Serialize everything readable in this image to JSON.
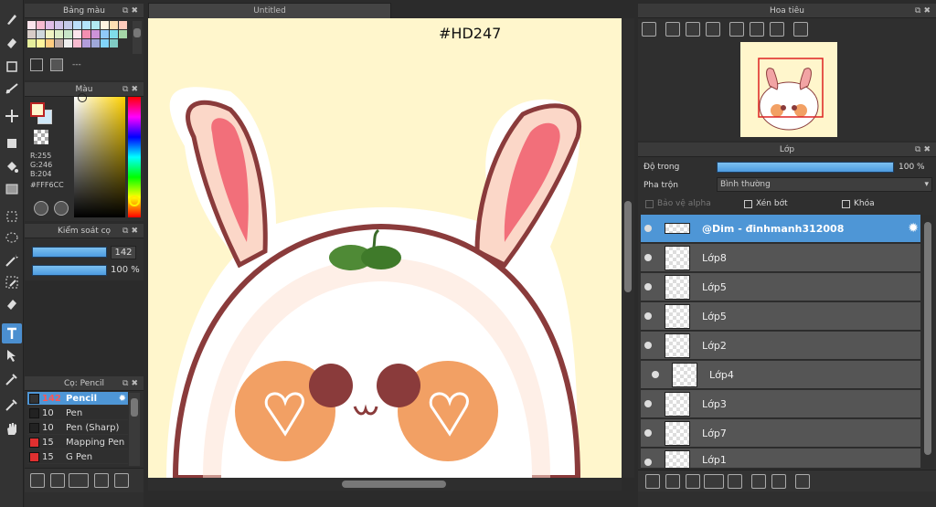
{
  "canvas": {
    "tab_title": "Untitled",
    "watermark": "#HD247",
    "background": "#FFF6CC"
  },
  "palette_panel": {
    "title": "Bảng màu",
    "label": "---",
    "swatches": [
      "#fce4ec",
      "#f8bbd0",
      "#e1bee7",
      "#d1c4e9",
      "#c5cae9",
      "#bbdefb",
      "#b3e5fc",
      "#b2ebf2",
      "#fff3e0",
      "#ffe0b2",
      "#ffccbc",
      "#d7ccc8",
      "#cfd8dc",
      "#f0f4c3",
      "#dcedc8",
      "#c8e6c9",
      "#fce4ec",
      "#f48fb1",
      "#ce93d8",
      "#90caf9",
      "#80deea",
      "#a5d6a7",
      "#e6ee9c",
      "#fff59d",
      "#ffcc80",
      "#bcaaa4",
      "#eeeeee",
      "#f8bbd0",
      "#b39ddb",
      "#9fa8da",
      "#81d4fa",
      "#80cbc4"
    ]
  },
  "color_panel": {
    "title": "Màu",
    "r": "R:255",
    "g": "G:246",
    "b": "B:204",
    "hex": "#FFF6CC",
    "main_color": "#FFF6CC",
    "sub_color": "#7a1a1a"
  },
  "brush_control": {
    "title": "Kiểm soát cọ",
    "size_value": "142",
    "opacity_value": "100 %"
  },
  "brush_panel": {
    "title": "Cọ: Pencil",
    "items": [
      {
        "size": "142",
        "name": "Pencil",
        "color": "#333333"
      },
      {
        "size": "10",
        "name": "Pen",
        "color": "#222222"
      },
      {
        "size": "10",
        "name": "Pen (Sharp)",
        "color": "#222222"
      },
      {
        "size": "15",
        "name": "Mapping Pen",
        "color": "#e03030"
      },
      {
        "size": "15",
        "name": "G Pen",
        "color": "#e03030"
      }
    ]
  },
  "navigator": {
    "title": "Hoa tiêu"
  },
  "layer_panel": {
    "title": "Lớp",
    "opacity_label": "Độ trong",
    "opacity_value": "100 %",
    "blend_label": "Pha trộn",
    "blend_value": "Bình thường",
    "protect_alpha": "Bảo vệ alpha",
    "clipping": "Xén bớt",
    "lock": "Khóa",
    "layers": [
      {
        "name": "@Dim - đinhmanh312008",
        "selected": true
      },
      {
        "name": "Lớp8"
      },
      {
        "name": "Lớp5"
      },
      {
        "name": "Lớp5"
      },
      {
        "name": "Lớp2"
      },
      {
        "name": "Lớp4"
      },
      {
        "name": "Lớp3"
      },
      {
        "name": "Lớp7"
      },
      {
        "name": "Lớp1"
      }
    ]
  }
}
